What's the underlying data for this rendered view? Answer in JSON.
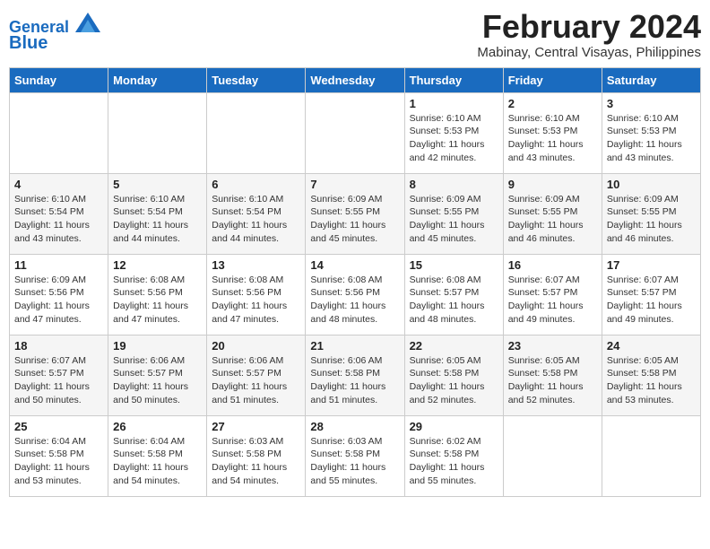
{
  "header": {
    "logo_line1": "General",
    "logo_line2": "Blue",
    "month_year": "February 2024",
    "location": "Mabinay, Central Visayas, Philippines"
  },
  "weekdays": [
    "Sunday",
    "Monday",
    "Tuesday",
    "Wednesday",
    "Thursday",
    "Friday",
    "Saturday"
  ],
  "weeks": [
    [
      {
        "day": "",
        "info": ""
      },
      {
        "day": "",
        "info": ""
      },
      {
        "day": "",
        "info": ""
      },
      {
        "day": "",
        "info": ""
      },
      {
        "day": "1",
        "info": "Sunrise: 6:10 AM\nSunset: 5:53 PM\nDaylight: 11 hours\nand 42 minutes."
      },
      {
        "day": "2",
        "info": "Sunrise: 6:10 AM\nSunset: 5:53 PM\nDaylight: 11 hours\nand 43 minutes."
      },
      {
        "day": "3",
        "info": "Sunrise: 6:10 AM\nSunset: 5:53 PM\nDaylight: 11 hours\nand 43 minutes."
      }
    ],
    [
      {
        "day": "4",
        "info": "Sunrise: 6:10 AM\nSunset: 5:54 PM\nDaylight: 11 hours\nand 43 minutes."
      },
      {
        "day": "5",
        "info": "Sunrise: 6:10 AM\nSunset: 5:54 PM\nDaylight: 11 hours\nand 44 minutes."
      },
      {
        "day": "6",
        "info": "Sunrise: 6:10 AM\nSunset: 5:54 PM\nDaylight: 11 hours\nand 44 minutes."
      },
      {
        "day": "7",
        "info": "Sunrise: 6:09 AM\nSunset: 5:55 PM\nDaylight: 11 hours\nand 45 minutes."
      },
      {
        "day": "8",
        "info": "Sunrise: 6:09 AM\nSunset: 5:55 PM\nDaylight: 11 hours\nand 45 minutes."
      },
      {
        "day": "9",
        "info": "Sunrise: 6:09 AM\nSunset: 5:55 PM\nDaylight: 11 hours\nand 46 minutes."
      },
      {
        "day": "10",
        "info": "Sunrise: 6:09 AM\nSunset: 5:55 PM\nDaylight: 11 hours\nand 46 minutes."
      }
    ],
    [
      {
        "day": "11",
        "info": "Sunrise: 6:09 AM\nSunset: 5:56 PM\nDaylight: 11 hours\nand 47 minutes."
      },
      {
        "day": "12",
        "info": "Sunrise: 6:08 AM\nSunset: 5:56 PM\nDaylight: 11 hours\nand 47 minutes."
      },
      {
        "day": "13",
        "info": "Sunrise: 6:08 AM\nSunset: 5:56 PM\nDaylight: 11 hours\nand 47 minutes."
      },
      {
        "day": "14",
        "info": "Sunrise: 6:08 AM\nSunset: 5:56 PM\nDaylight: 11 hours\nand 48 minutes."
      },
      {
        "day": "15",
        "info": "Sunrise: 6:08 AM\nSunset: 5:57 PM\nDaylight: 11 hours\nand 48 minutes."
      },
      {
        "day": "16",
        "info": "Sunrise: 6:07 AM\nSunset: 5:57 PM\nDaylight: 11 hours\nand 49 minutes."
      },
      {
        "day": "17",
        "info": "Sunrise: 6:07 AM\nSunset: 5:57 PM\nDaylight: 11 hours\nand 49 minutes."
      }
    ],
    [
      {
        "day": "18",
        "info": "Sunrise: 6:07 AM\nSunset: 5:57 PM\nDaylight: 11 hours\nand 50 minutes."
      },
      {
        "day": "19",
        "info": "Sunrise: 6:06 AM\nSunset: 5:57 PM\nDaylight: 11 hours\nand 50 minutes."
      },
      {
        "day": "20",
        "info": "Sunrise: 6:06 AM\nSunset: 5:57 PM\nDaylight: 11 hours\nand 51 minutes."
      },
      {
        "day": "21",
        "info": "Sunrise: 6:06 AM\nSunset: 5:58 PM\nDaylight: 11 hours\nand 51 minutes."
      },
      {
        "day": "22",
        "info": "Sunrise: 6:05 AM\nSunset: 5:58 PM\nDaylight: 11 hours\nand 52 minutes."
      },
      {
        "day": "23",
        "info": "Sunrise: 6:05 AM\nSunset: 5:58 PM\nDaylight: 11 hours\nand 52 minutes."
      },
      {
        "day": "24",
        "info": "Sunrise: 6:05 AM\nSunset: 5:58 PM\nDaylight: 11 hours\nand 53 minutes."
      }
    ],
    [
      {
        "day": "25",
        "info": "Sunrise: 6:04 AM\nSunset: 5:58 PM\nDaylight: 11 hours\nand 53 minutes."
      },
      {
        "day": "26",
        "info": "Sunrise: 6:04 AM\nSunset: 5:58 PM\nDaylight: 11 hours\nand 54 minutes."
      },
      {
        "day": "27",
        "info": "Sunrise: 6:03 AM\nSunset: 5:58 PM\nDaylight: 11 hours\nand 54 minutes."
      },
      {
        "day": "28",
        "info": "Sunrise: 6:03 AM\nSunset: 5:58 PM\nDaylight: 11 hours\nand 55 minutes."
      },
      {
        "day": "29",
        "info": "Sunrise: 6:02 AM\nSunset: 5:58 PM\nDaylight: 11 hours\nand 55 minutes."
      },
      {
        "day": "",
        "info": ""
      },
      {
        "day": "",
        "info": ""
      }
    ]
  ]
}
